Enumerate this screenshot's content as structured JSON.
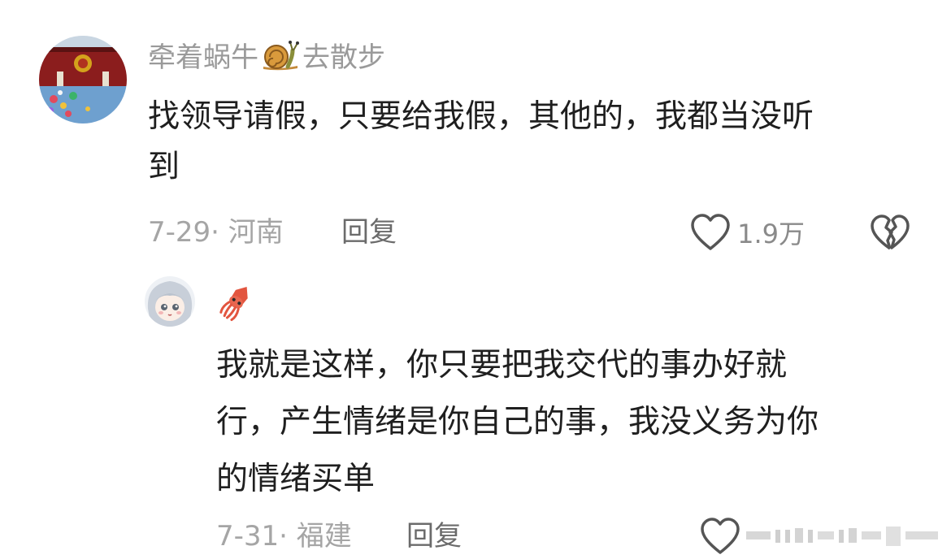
{
  "comment": {
    "username_before": "牵着蜗牛",
    "username_after": "去散步",
    "text_line1": "找领导请假，只要给我假，其他的，我都当没听",
    "text_line2": "到",
    "date_location": "7-29· 河南",
    "reply_label": "回复",
    "like_count": "1.9万"
  },
  "reply": {
    "text_line1": "我就是这样，你只要把我交代的事办好就",
    "text_line2": "行，产生情绪是你自己的事，我没义务为你",
    "text_line3": "的情绪买单",
    "date_location": "7-31· 福建",
    "reply_label": "回复"
  },
  "icons": {
    "like": "heart-outline-icon",
    "dislike": "broken-heart-icon",
    "snail_emoji": "snail-icon",
    "squid_emoji": "squid-icon"
  },
  "colors": {
    "text": "#1f1f1f",
    "username": "#9a9a9a",
    "meta": "#a5a5a5"
  }
}
